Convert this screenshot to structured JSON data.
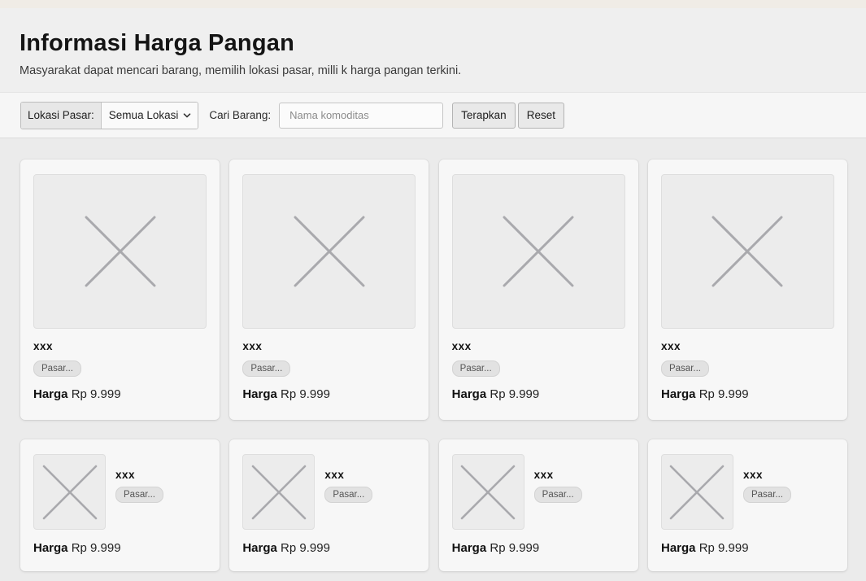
{
  "header": {
    "title": "Informasi Harga Pangan",
    "subtitle": "Masyarakat dapat mencari barang, memilih lokasi pasar, milli k harga pangan terkini."
  },
  "toolbar": {
    "location_label": "Lokasi Pasar:",
    "location_value": "Semua Lokasi",
    "search_label": "Cari Barang:",
    "search_placeholder": "Nama komoditas",
    "search_value": "",
    "apply_label": "Terapkan",
    "reset_label": "Reset"
  },
  "price_prefix": "Harga",
  "cards_large": [
    {
      "name": "xxx",
      "market": "Pasar...",
      "price": "Rp 9.999"
    },
    {
      "name": "xxx",
      "market": "Pasar...",
      "price": "Rp 9.999"
    },
    {
      "name": "xxx",
      "market": "Pasar...",
      "price": "Rp 9.999"
    },
    {
      "name": "xxx",
      "market": "Pasar...",
      "price": "Rp 9.999"
    }
  ],
  "cards_small": [
    {
      "name": "xxx",
      "market": "Pasar...",
      "price": "Rp 9.999"
    },
    {
      "name": "xxx",
      "market": "Pasar...",
      "price": "Rp 9.999"
    },
    {
      "name": "xxx",
      "market": "Pasar...",
      "price": "Rp 9.999"
    },
    {
      "name": "xxx",
      "market": "Pasar...",
      "price": "Rp 9.999"
    }
  ],
  "colors": {
    "placeholder_cross": "#a9a9ad",
    "card_bg": "#f7f7f7",
    "page_bg": "#ebebeb"
  },
  "icons": {
    "image_placeholder": "image-placeholder-icon",
    "dropdown": "chevron-down-icon"
  }
}
